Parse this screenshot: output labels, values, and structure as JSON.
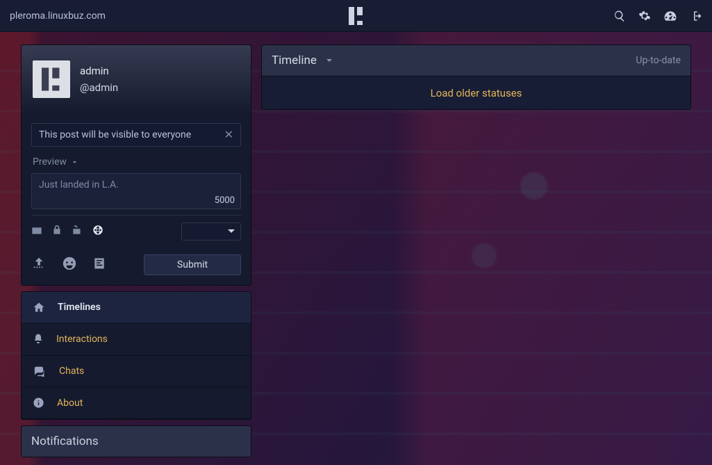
{
  "site_title": "pleroma.linuxbuz.com",
  "user": {
    "display_name": "admin",
    "handle": "@admin"
  },
  "composer": {
    "cw_text": "This post will be visible to everyone",
    "preview_label": "Preview",
    "placeholder": "Just landed in L.A.",
    "char_limit": "5000",
    "submit_label": "Submit"
  },
  "nav": {
    "timelines": "Timelines",
    "interactions": "Interactions",
    "chats": "Chats",
    "about": "About"
  },
  "notifications_header": "Notifications",
  "timeline": {
    "title": "Timeline",
    "status": "Up-to-date",
    "load_older": "Load older statuses"
  }
}
